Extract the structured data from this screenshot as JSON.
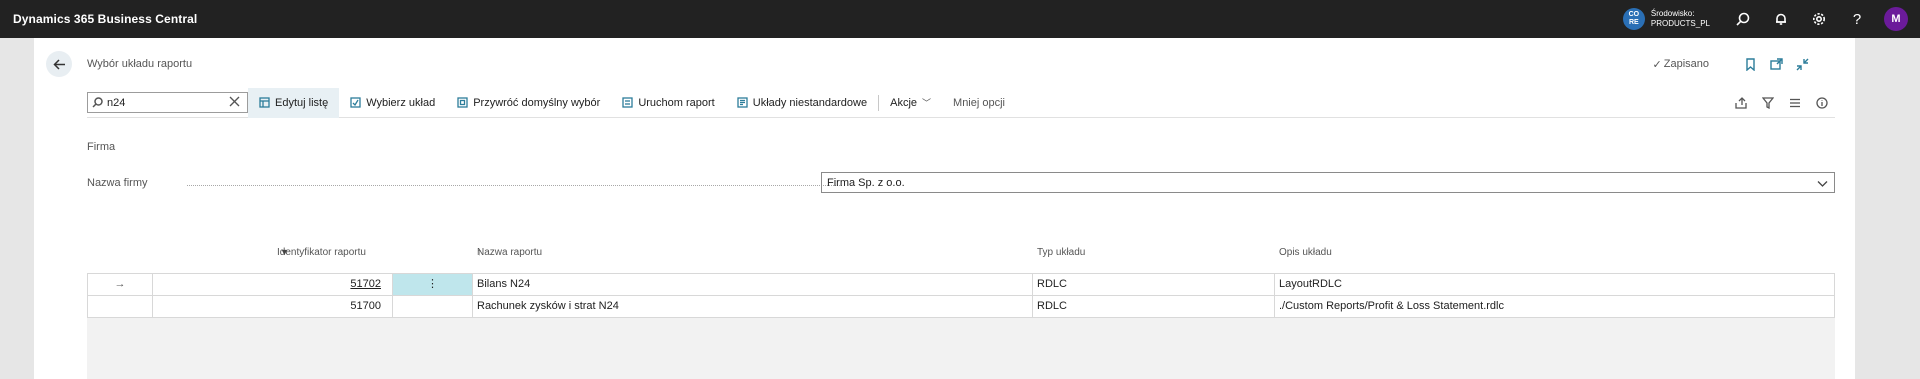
{
  "app": {
    "title": "Dynamics 365 Business Central",
    "env_badge_line1": "CO",
    "env_badge_line2": "RE",
    "env_label": "Środowisko:",
    "env_name": "PRODUCTS_PL",
    "help_glyph": "?",
    "avatar_initial": "M"
  },
  "page": {
    "title": "Wybór układu raportu",
    "saved_label": "Zapisano"
  },
  "search": {
    "value": "n24"
  },
  "actions": [
    {
      "label": "Edytuj listę",
      "icon": "edit-list-icon"
    },
    {
      "label": "Wybierz układ",
      "icon": "select-layout-icon"
    },
    {
      "label": "Przywróć domyślny wybór",
      "icon": "restore-default-icon"
    },
    {
      "label": "Uruchom raport",
      "icon": "run-report-icon"
    },
    {
      "label": "Układy niestandardowe",
      "icon": "custom-layouts-icon"
    },
    {
      "label": "Akcje"
    },
    {
      "label": "Mniej opcji"
    }
  ],
  "section": {
    "title": "Firma",
    "field_label": "Nazwa firmy",
    "field_value": "Firma Sp. z o.o."
  },
  "table": {
    "columns": [
      "Identyfikator raportu",
      "Nazwa raportu",
      "Typ układu",
      "Opis układu"
    ],
    "sort_glyph": "↑",
    "rows": [
      {
        "marker": "→",
        "id": "51702",
        "menu": "⋮",
        "name": "Bilans N24",
        "type": "RDLC",
        "desc": "LayoutRDLC"
      },
      {
        "marker": "",
        "id": "51700",
        "menu": "",
        "name": "Rachunek zysków i strat N24",
        "type": "RDLC",
        "desc": "./Custom Reports/Profit & Loss Statement.rdlc"
      }
    ]
  }
}
